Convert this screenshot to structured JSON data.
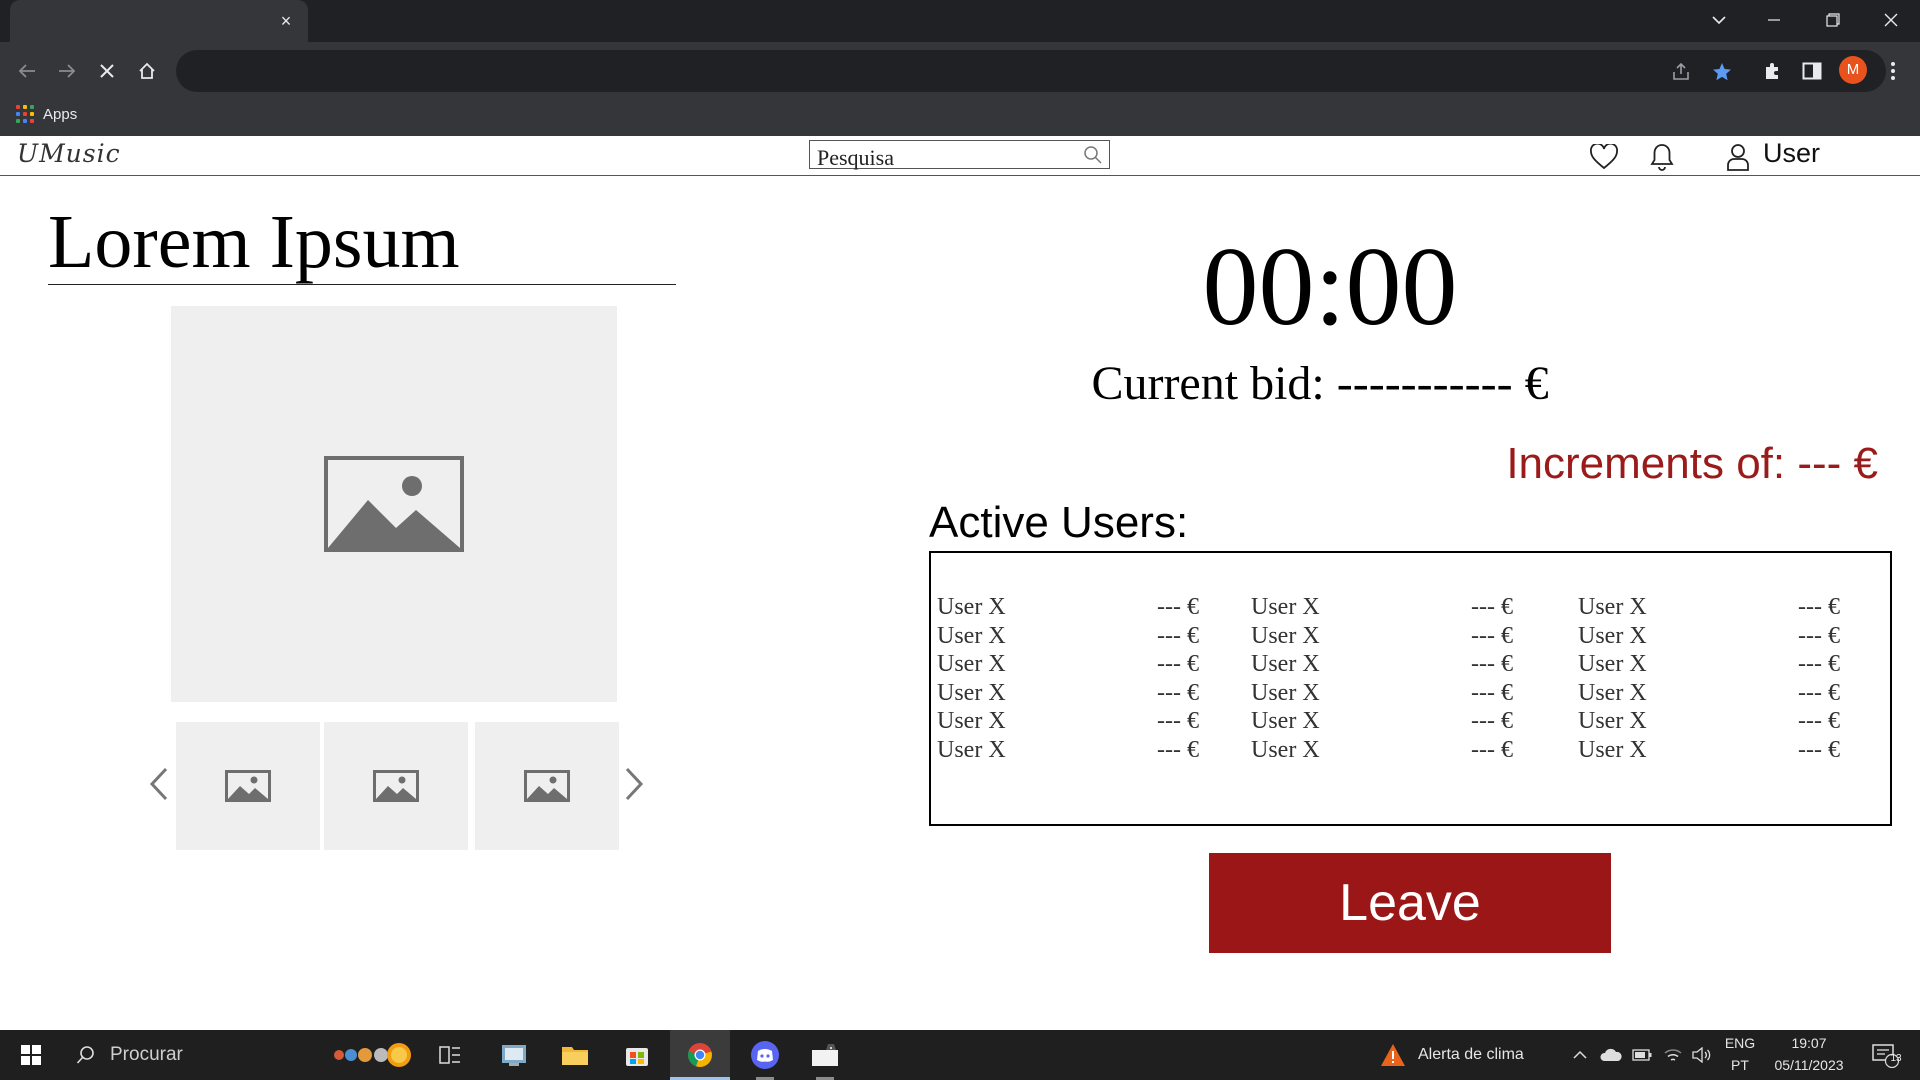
{
  "browser": {
    "tab_close": "×",
    "bookmarks": [
      {
        "label": "Apps"
      }
    ],
    "profile_initial": "M"
  },
  "site": {
    "logo": "UMusic",
    "search": {
      "placeholder": "Pesquisa"
    },
    "user_label": "User"
  },
  "product": {
    "title": "Lorem Ipsum",
    "thumbnails": 3
  },
  "auction": {
    "timer": "00:00",
    "current_bid": "Current bid: ----------- €",
    "increments": "Increments of: --- €",
    "active_users_heading": "Active Users:",
    "columns": [
      [
        {
          "name": "User X",
          "bid": "--- €"
        },
        {
          "name": "User X",
          "bid": "--- €"
        },
        {
          "name": "User X",
          "bid": "--- €"
        },
        {
          "name": "User X",
          "bid": "--- €"
        },
        {
          "name": "User X",
          "bid": "--- €"
        },
        {
          "name": "User X",
          "bid": "--- €"
        }
      ],
      [
        {
          "name": "User X",
          "bid": "--- €"
        },
        {
          "name": "User X",
          "bid": "--- €"
        },
        {
          "name": "User X",
          "bid": "--- €"
        },
        {
          "name": "User X",
          "bid": "--- €"
        },
        {
          "name": "User X",
          "bid": "--- €"
        },
        {
          "name": "User X",
          "bid": "--- €"
        }
      ],
      [
        {
          "name": "User X",
          "bid": "--- €"
        },
        {
          "name": "User X",
          "bid": "--- €"
        },
        {
          "name": "User X",
          "bid": "--- €"
        },
        {
          "name": "User X",
          "bid": "--- €"
        },
        {
          "name": "User X",
          "bid": "--- €"
        },
        {
          "name": "User X",
          "bid": "--- €"
        }
      ]
    ],
    "leave_label": "Leave"
  },
  "taskbar": {
    "search_label": "Procurar",
    "weather_label": "Alerta de clima",
    "lang_top": "ENG",
    "lang_bottom": "PT",
    "time": "19:07",
    "date": "05/11/2023",
    "notification_count": "13"
  },
  "colors": {
    "accent_red": "#9b1616",
    "increments_red": "#9b1b1b",
    "chrome_dark": "#202124",
    "chrome_mid": "#35363a",
    "placeholder_gray": "#efefef",
    "taskbar": "#1f1f1f"
  }
}
